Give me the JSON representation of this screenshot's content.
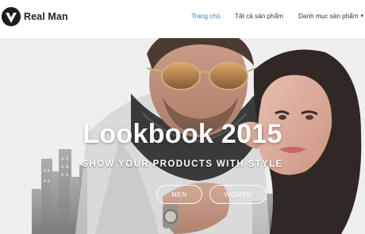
{
  "brand": {
    "name": "Real Man"
  },
  "nav": {
    "items": [
      {
        "label": "Trang chủ",
        "active": true
      },
      {
        "label": "Tất cả sản phẩm",
        "active": false
      },
      {
        "label": "Danh mục sản phẩm",
        "active": false,
        "has_dropdown": true
      }
    ]
  },
  "hero": {
    "title": "Lookbook 2015",
    "subtitle": "SHOW YOUR PRODUCTS WITH STYLE",
    "buttons": {
      "men": "MEN",
      "women": "WOMEN"
    }
  },
  "colors": {
    "accent": "#3a7bd5",
    "text": "#333333",
    "logo": "#1c1c1c"
  }
}
